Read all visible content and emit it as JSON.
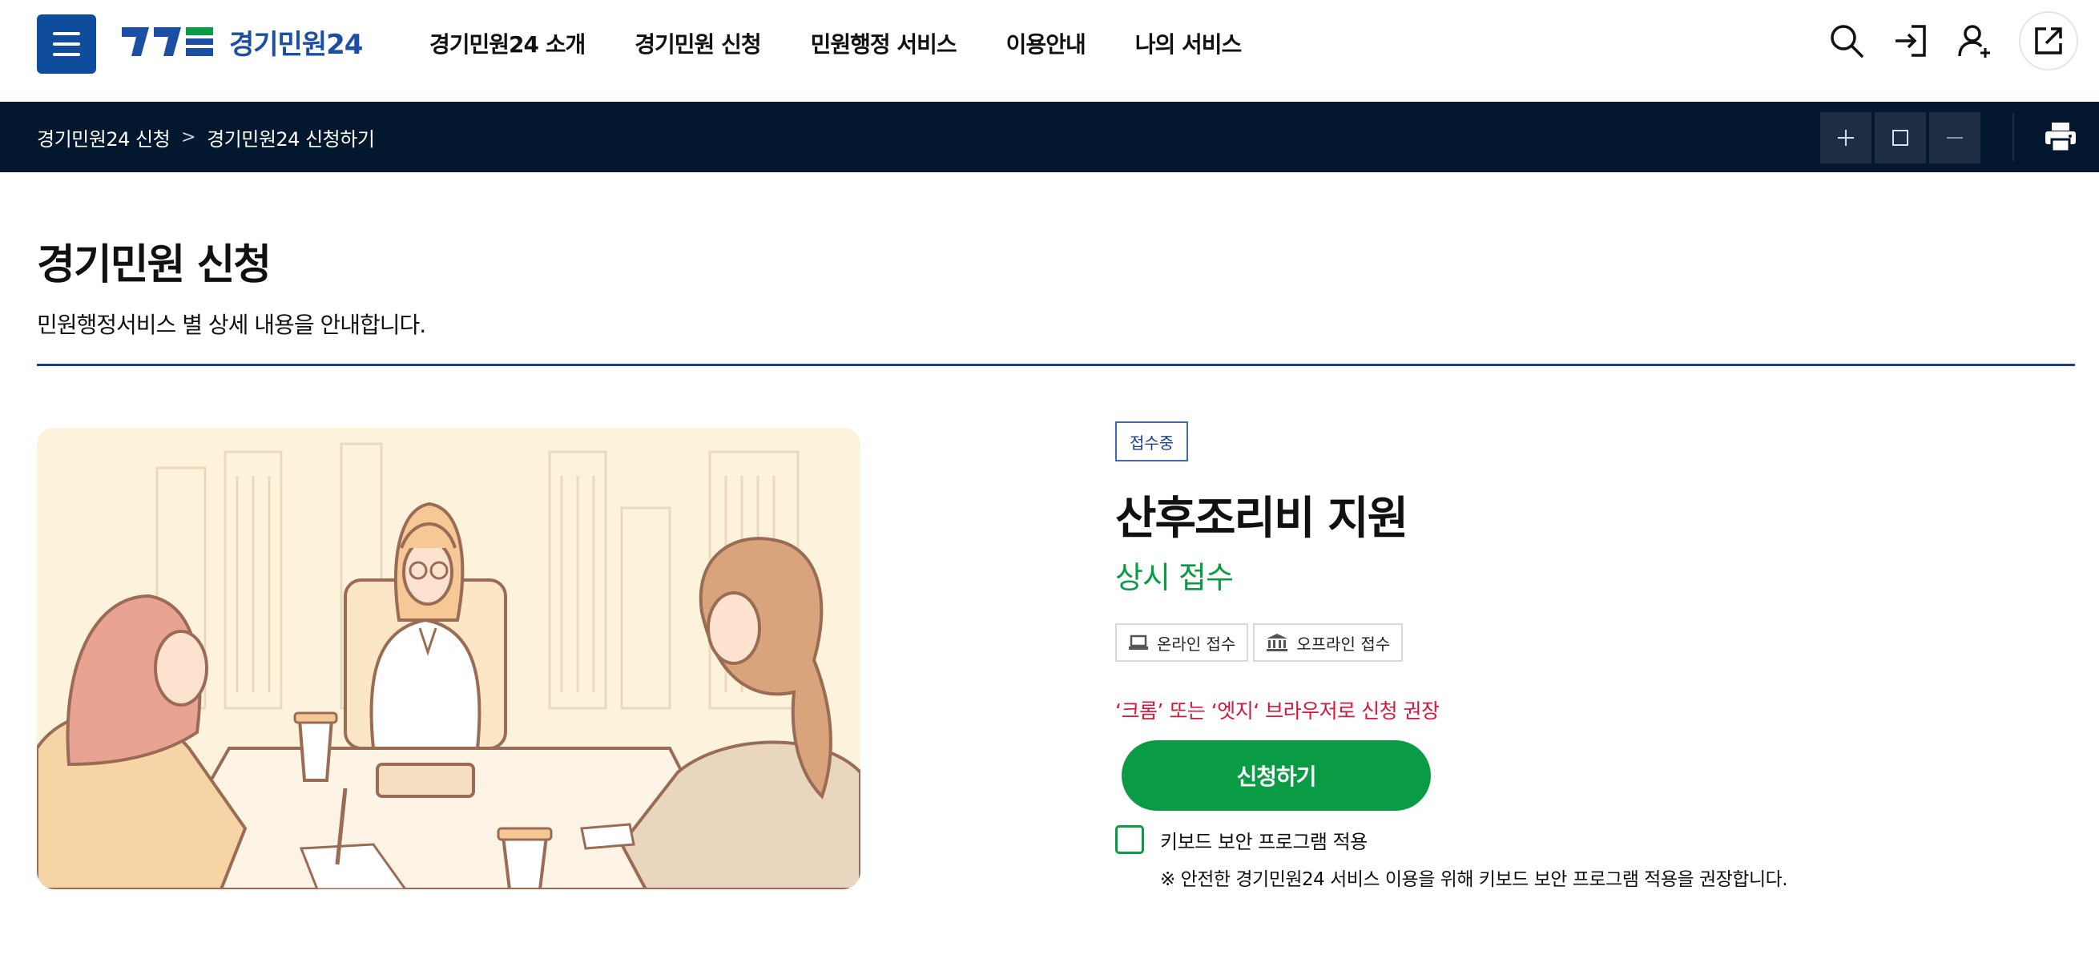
{
  "header": {
    "logo_text": "경기민원24",
    "nav": [
      "경기민원24 소개",
      "경기민원 신청",
      "민원행정 서비스",
      "이용안내",
      "나의 서비스"
    ],
    "icons": [
      "menu-icon",
      "search-icon",
      "login-icon",
      "user-add-icon",
      "external-link-icon"
    ],
    "brand_color": "#0f4c9c"
  },
  "breadcrumb": {
    "items": [
      "경기민원24 신청",
      "경기민원24 신청하기"
    ],
    "separator": ">",
    "zoom_icons": [
      "plus-icon",
      "square-icon",
      "minus-icon"
    ],
    "print_icon": "printer-icon",
    "bar_color": "#03172f"
  },
  "page": {
    "title": "경기민원 신청",
    "description": "민원행정서비스 별 상세 내용을 안내합니다."
  },
  "service": {
    "status_badge": "접수중",
    "title": "산후조리비 지원",
    "period": "상시 접수",
    "chips": [
      {
        "icon": "laptop-icon",
        "label": "온라인 접수"
      },
      {
        "icon": "government-building-icon",
        "label": "오프라인 접수"
      }
    ],
    "browser_notice": "‘크롬’ 또는 ‘엣지‘ 브라우저로 신청 권장",
    "apply_label": "신청하기",
    "keyboard_security_label": "키보드 보안 프로그램 적용",
    "keyboard_security_note": "※ 안전한 경기민원24 서비스 이용을 위해 키보드 보안 프로그램 적용을 권장합니다.",
    "accent_color": "#0a9b45",
    "notice_color": "#d6163a"
  }
}
